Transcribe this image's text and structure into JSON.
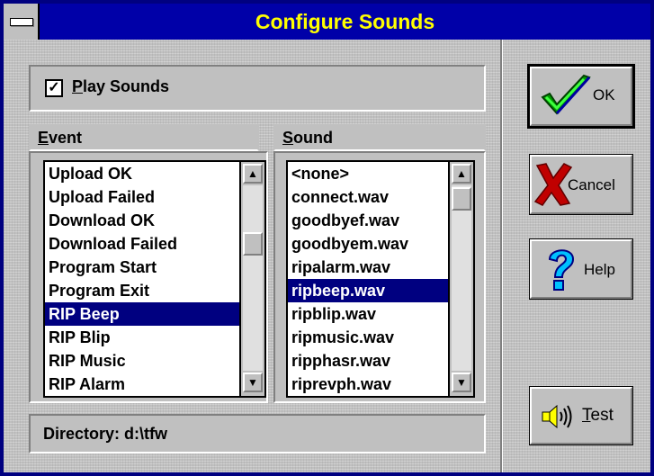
{
  "window": {
    "title": "Configure Sounds"
  },
  "play_sounds": {
    "label": "Play Sounds",
    "checked": true
  },
  "event": {
    "header": "Event",
    "items": [
      "Upload OK",
      "Upload Failed",
      "Download OK",
      "Download Failed",
      "Program Start",
      "Program Exit",
      "RIP Beep",
      "RIP Blip",
      "RIP Music",
      "RIP Alarm"
    ],
    "selected": "RIP Beep"
  },
  "sound": {
    "header": "Sound",
    "items": [
      "<none>",
      "connect.wav",
      "goodbyef.wav",
      "goodbyem.wav",
      "ripalarm.wav",
      "ripbeep.wav",
      "ripblip.wav",
      "ripmusic.wav",
      "ripphasr.wav",
      "riprevph.wav"
    ],
    "selected": "ripbeep.wav"
  },
  "directory": "Directory: d:\\tfw",
  "buttons": {
    "ok": "OK",
    "cancel": "Cancel",
    "help": "Help",
    "test": "Test"
  },
  "colors": {
    "title_bg": "#0000a8",
    "title_text": "#ffff00",
    "selection": "#000080"
  }
}
